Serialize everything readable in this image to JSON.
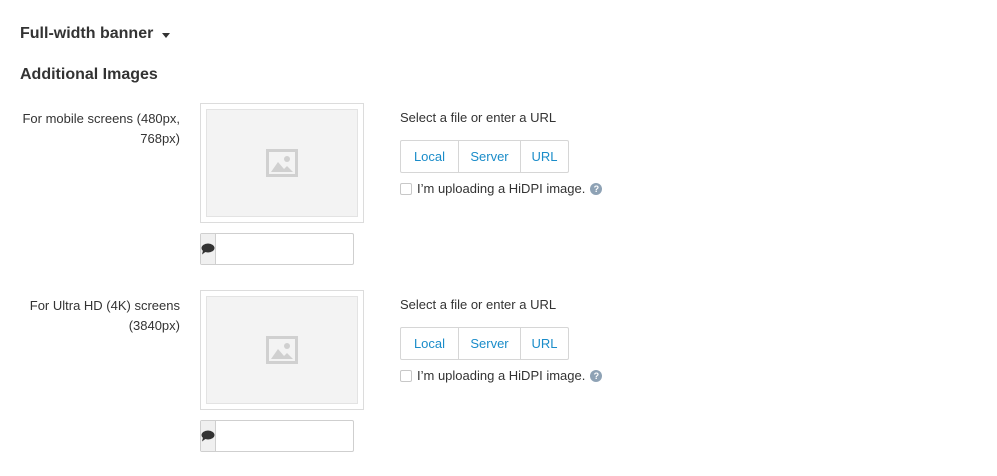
{
  "banner": {
    "title": "Full-width banner"
  },
  "section": {
    "title": "Additional Images"
  },
  "rows": [
    {
      "label_line1": "For mobile screens (480px,",
      "label_line2": "768px)",
      "select_label": "Select a file or enter a URL",
      "buttons": {
        "local": "Local",
        "server": "Server",
        "url": "URL"
      },
      "hidpi_label": "I’m uploading a HiDPI image.",
      "hidpi_checked": false,
      "alt_text_value": ""
    },
    {
      "label_line1": "For Ultra HD (4K) screens",
      "label_line2": "(3840px)",
      "select_label": "Select a file or enter a URL",
      "buttons": {
        "local": "Local",
        "server": "Server",
        "url": "URL"
      },
      "hidpi_label": "I’m uploading a HiDPI image.",
      "hidpi_checked": false,
      "alt_text_value": ""
    }
  ],
  "colors": {
    "link": "#1a8cc9",
    "help_icon": "#8ea2b5",
    "placeholder_bg": "#f3f3f3"
  },
  "icons": {
    "preview": "image-placeholder-icon",
    "alt": "speech-bubble-icon",
    "help": "question-icon",
    "toggle": "caret-down-icon"
  }
}
